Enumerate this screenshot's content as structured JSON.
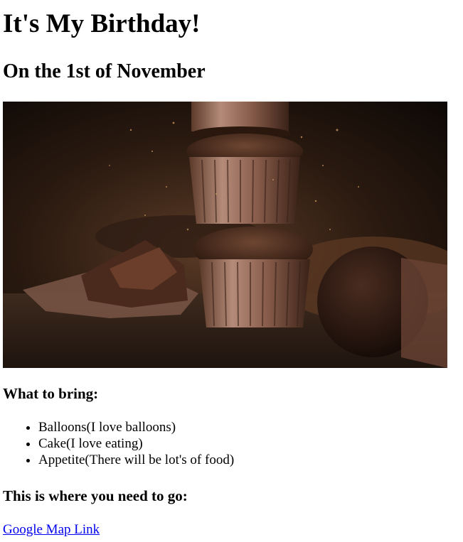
{
  "header": {
    "title": "It's My Birthday!",
    "subtitle": "On the 1st of November"
  },
  "hero_image": {
    "subject": "stacked-chocolate-cupcakes-photo"
  },
  "bring": {
    "heading": "What to bring:",
    "items": [
      "Balloons(I love balloons)",
      "Cake(I love eating)",
      "Appetite(There will be lot's of food)"
    ]
  },
  "directions": {
    "heading": "This is where you need to go:",
    "link_text": "Google Map Link"
  },
  "colors": {
    "link": "#0000ee",
    "text": "#000000",
    "background": "#ffffff"
  }
}
